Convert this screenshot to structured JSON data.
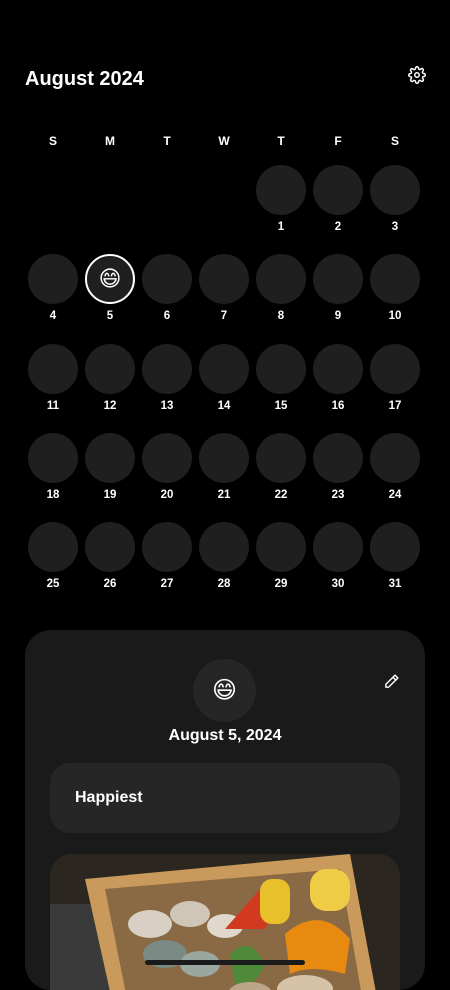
{
  "header": {
    "title": "August 2024",
    "settings_icon": "gear-icon"
  },
  "calendar": {
    "weekdays": [
      "S",
      "M",
      "T",
      "W",
      "T",
      "F",
      "S"
    ],
    "first_weekday_index": 4,
    "days": [
      "1",
      "2",
      "3",
      "4",
      "5",
      "6",
      "7",
      "8",
      "9",
      "10",
      "11",
      "12",
      "13",
      "14",
      "15",
      "16",
      "17",
      "18",
      "19",
      "20",
      "21",
      "22",
      "23",
      "24",
      "25",
      "26",
      "27",
      "28",
      "29",
      "30",
      "31"
    ],
    "selected_day": "5",
    "entries": {
      "5": "😄"
    }
  },
  "detail": {
    "emoji": "😄",
    "edit_icon": "pencil-icon",
    "date": "August 5, 2024",
    "mood": "Happiest",
    "photo_desc_icon": "food-photo"
  },
  "colors": {
    "background": "#000000",
    "circle": "#1f1f1f",
    "panel": "#1a1a1a",
    "card": "#262626"
  }
}
